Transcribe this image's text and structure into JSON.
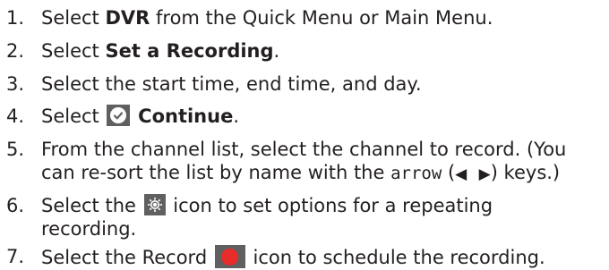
{
  "steps": [
    {
      "num": "1.",
      "pre": "Select ",
      "bold": "DVR",
      "post": " from the Quick Menu or Main Menu."
    },
    {
      "num": "2.",
      "pre": "Select ",
      "bold": "Set a Recording",
      "post": "."
    },
    {
      "num": "3.",
      "text": "Select the start time, end time, and day."
    },
    {
      "num": "4.",
      "pre": "Select ",
      "bold": "Continue",
      "post": "."
    },
    {
      "num": "5.",
      "line1": "From the channel list, select the channel to record. (You",
      "line2_pre": "can re-sort the list by name with the ",
      "line2_code": "arrow",
      "line2_paren_open": " (",
      "arrow_left": "◀",
      "arrow_right": "▶",
      "line2_post": ") keys.)"
    },
    {
      "num": "6.",
      "pre": "Select the ",
      "post": " icon to set options for a repeating",
      "line2": "recording."
    },
    {
      "num": "7.",
      "pre": "Select the Record ",
      "post": " icon to schedule the recording."
    }
  ],
  "icons": {
    "continue": "check-circle-icon",
    "options": "gear-options-icon",
    "record": "record-dot-icon"
  },
  "colors": {
    "text": "#231f20",
    "icon_bg": "#606060",
    "record_red": "#e82c2a"
  }
}
